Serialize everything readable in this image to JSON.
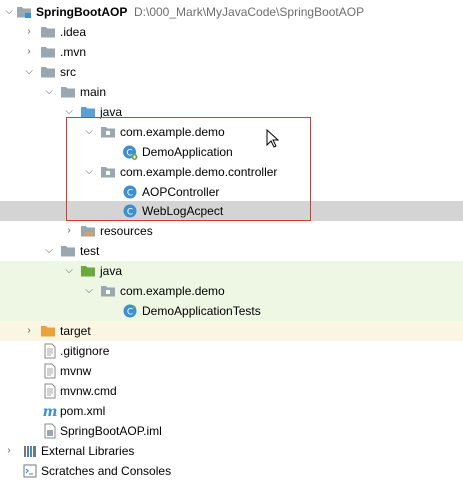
{
  "project": {
    "name": "SpringBootAOP",
    "path": "D:\\000_Mark\\MyJavaCode\\SpringBootAOP"
  },
  "tree": {
    "idea": ".idea",
    "mvn": ".mvn",
    "src": "src",
    "main": "main",
    "main_java": "java",
    "pkg_demo": "com.example.demo",
    "demo_app": "DemoApplication",
    "pkg_controller": "com.example.demo.controller",
    "aop_controller": "AOPController",
    "weblog": "WebLogAcpect",
    "resources": "resources",
    "test": "test",
    "test_java": "java",
    "test_pkg": "com.example.demo",
    "demo_tests": "DemoApplicationTests",
    "target": "target",
    "gitignore": ".gitignore",
    "mvnw": "mvnw",
    "mvnw_cmd": "mvnw.cmd",
    "pom": "pom.xml",
    "iml": "SpringBootAOP.iml"
  },
  "bottom": {
    "external_libraries": "External Libraries",
    "scratches": "Scratches and Consoles"
  },
  "colors": {
    "folder": "#9aa7b0",
    "source_folder": "#5e9fd6",
    "test_folder": "#6aaa3c",
    "target_folder": "#e8a33d",
    "class_icon": "#3d8fcf",
    "highlight_box": "#e0352b",
    "selection": "#d4d4d4"
  }
}
